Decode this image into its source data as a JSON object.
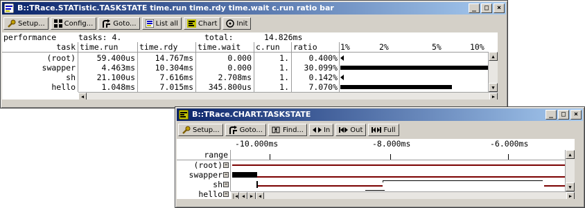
{
  "stat_window": {
    "title": "B::TRace.STATistic.TASKSTATE time.run time.rdy time.wait c.run ratio bar",
    "toolbar": {
      "setup": "Setup...",
      "config": "Config...",
      "goto": "Goto...",
      "list_all": "List all",
      "chart": "Chart",
      "init": "Init"
    },
    "summary": {
      "label": "performance",
      "tasks": "tasks: 4.",
      "total": "total:",
      "total_value": "14.826ms"
    },
    "headers": [
      "task",
      "time.run",
      "time.rdy",
      "time.wait",
      "c.run",
      "ratio"
    ],
    "scale_labels": [
      "1%",
      "2%",
      "5%",
      "10%"
    ],
    "rows": [
      {
        "task": "(root)",
        "time_run": "59.400us",
        "time_rdy": "14.767ms",
        "time_wait": "0.000",
        "c_run": "1.",
        "ratio": "0.400%",
        "ratio_value": 0.4
      },
      {
        "task": "swapper",
        "time_run": "4.463ms",
        "time_rdy": "10.304ms",
        "time_wait": "0.000",
        "c_run": "1.",
        "ratio": "30.099%",
        "ratio_value": 30.099
      },
      {
        "task": "sh",
        "time_run": "21.100us",
        "time_rdy": "7.616ms",
        "time_wait": "2.708ms",
        "c_run": "1.",
        "ratio": "0.142%",
        "ratio_value": 0.142
      },
      {
        "task": "hello",
        "time_run": "1.048ms",
        "time_rdy": "7.015ms",
        "time_wait": "345.800us",
        "c_run": "1.",
        "ratio": "7.070%",
        "ratio_value": 7.07
      }
    ]
  },
  "chart_window": {
    "title": "B::TRace.CHART.TASKSTATE",
    "toolbar": {
      "setup": "Setup...",
      "goto": "Goto...",
      "find": "Find...",
      "zoom_in": "In",
      "zoom_out": "Out",
      "full": "Full"
    },
    "time_labels": [
      "-10.000ms",
      "-8.000ms",
      "-6.000ms"
    ],
    "range_label": "range",
    "tasks": [
      "(root)",
      "swapper",
      "sh",
      "hello"
    ]
  },
  "colors": {
    "title_start": "#0a246a",
    "title_end": "#a6caf0",
    "bar_run": "#000000",
    "bar_ready": "#7a0000"
  }
}
